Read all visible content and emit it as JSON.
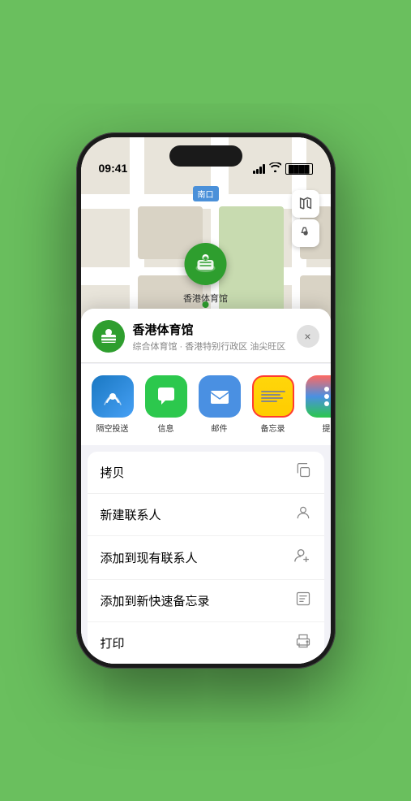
{
  "status": {
    "time": "09:41",
    "location_icon": "▶"
  },
  "map": {
    "label": "南口",
    "venue_name": "香港体育馆",
    "venue_label": "香港体育馆"
  },
  "venue": {
    "name": "香港体育馆",
    "description": "综合体育馆 · 香港特别行政区 油尖旺区",
    "close_label": "×"
  },
  "share_items": [
    {
      "id": "airdrop",
      "label": "隔空投送",
      "type": "airdrop"
    },
    {
      "id": "messages",
      "label": "信息",
      "type": "messages"
    },
    {
      "id": "mail",
      "label": "邮件",
      "type": "mail"
    },
    {
      "id": "notes",
      "label": "备忘录",
      "type": "notes"
    },
    {
      "id": "more",
      "label": "提",
      "type": "more-dots"
    }
  ],
  "actions": [
    {
      "id": "copy",
      "label": "拷贝",
      "icon": "⎘"
    },
    {
      "id": "new-contact",
      "label": "新建联系人",
      "icon": "👤"
    },
    {
      "id": "add-contact",
      "label": "添加到现有联系人",
      "icon": "👤"
    },
    {
      "id": "quick-note",
      "label": "添加到新快速备忘录",
      "icon": "📋"
    },
    {
      "id": "print",
      "label": "打印",
      "icon": "🖨"
    }
  ]
}
